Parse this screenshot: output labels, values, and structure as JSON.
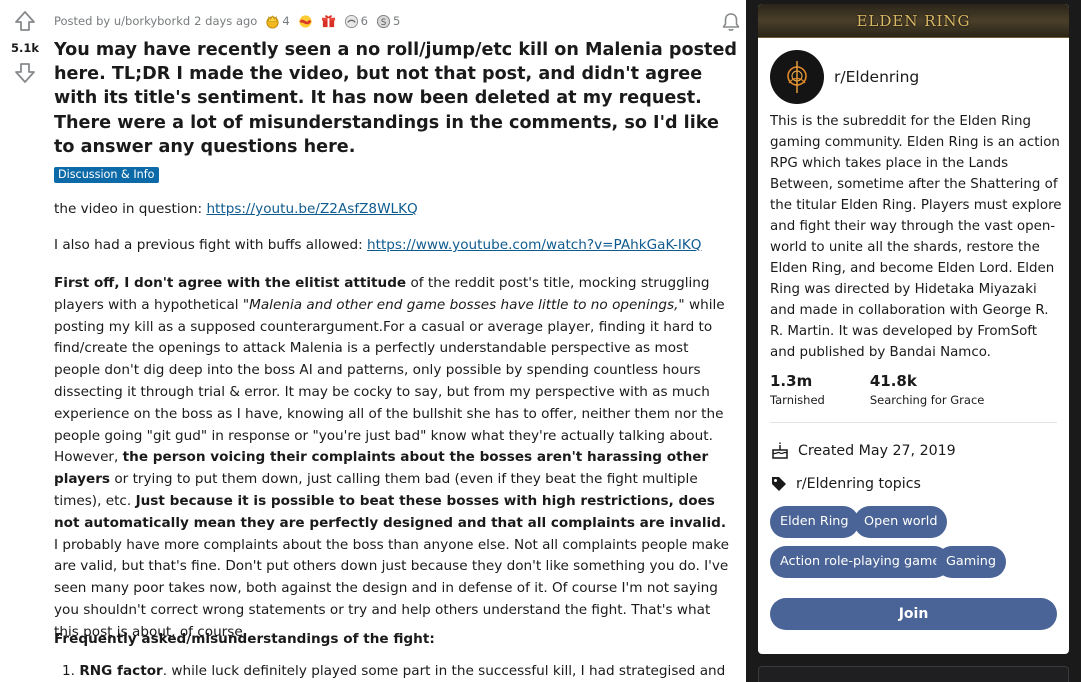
{
  "post": {
    "score": "5.1k",
    "posted_by": "Posted by u/borkyborkd",
    "time_ago": "2 days ago",
    "awards": [
      {
        "icon": "gold-award-icon",
        "count": "4"
      },
      {
        "icon": "wholesome-award-icon",
        "count": ""
      },
      {
        "icon": "gift-award-icon",
        "count": ""
      },
      {
        "icon": "hugz-award-icon",
        "count": "6"
      },
      {
        "icon": "silver-award-icon",
        "count": "5"
      }
    ],
    "title": "You may have recently seen a no roll/jump/etc kill on Malenia posted here. TL;DR I made the video, but not that post, and didn't agree with its title's sentiment. It has now been deleted at my request. There were a lot of misunderstandings in the comments, so I'd like to answer any questions here.",
    "flair": "Discussion & Info",
    "body": {
      "p1_prefix": "the video in question: ",
      "p1_link": "https://youtu.be/Z2AsfZ8WLKQ",
      "p2_prefix": "I also had a previous fight with buffs allowed: ",
      "p2_link": "https://www.youtube.com/watch?v=PAhkGaK-IKQ",
      "s1_bold": "First off, I don't agree with the elitist attitude",
      "s1_rest": " of the reddit post's title, mocking struggling players with a hypothetical ",
      "s1_italic": "\"Malenia and other end game bosses have little to no openings,\"",
      "s1_tail": " while posting my kill as a supposed counterargument.For a casual or average player, finding it hard to find/create the openings to attack Malenia is a perfectly understandable perspective as most people don't dig deep into the boss AI and patterns, only possible by spending countless hours dissecting it through trial & error. It may be cocky to say, but from my perspective with as much experience on the boss as I have, knowing all of the bullshit she has to offer, neither them nor the people going \"git gud\" in response or \"you're just bad\" know what they're actually talking about. However, ",
      "s2_bold": "the person voicing their complaints about the bosses aren't harassing other players",
      "s2_rest": " or trying to put them down, just calling them bad (even if they beat the fight multiple times), etc. ",
      "s3_bold": "Just because it is possible to beat these bosses with high restrictions, does not automatically mean they are perfectly designed and that all complaints are invalid.",
      "s3_rest": " I probably have more complaints about the boss than anyone else. Not all complaints people make are valid, but that's fine. Don't put others down just because they don't like something you do. I've seen many poor takes now, both against the design and in defense of it. Of course I'm not saying you shouldn't correct wrong statements or try and help others understand the fight. That's what this post is about, of course.",
      "faq_heading": "Frequently asked/misunderstandings of the fight:",
      "list1_num": "1.",
      "list1_bold": "RNG factor",
      "list1_rest": ". while luck definitely played some part in the successful kill, I had strategised and"
    }
  },
  "sidebar": {
    "banner": "ELDEN RING",
    "community_name": "r/Eldenring",
    "description": "This is the subreddit for the Elden Ring gaming community. Elden Ring is an action RPG which takes place in the Lands Between, sometime after the Shattering of the titular Elden Ring. Players must explore and fight their way through the vast open-world to unite all the shards, restore the Elden Ring, and become Elden Lord. Elden Ring was directed by Hidetaka Miyazaki and made in collaboration with George R. R. Martin. It was developed by FromSoft and published by Bandai Namco.",
    "members": "1.3m",
    "members_label": "Tarnished",
    "online": "41.8k",
    "online_label": "Searching for Grace",
    "created": "Created May 27, 2019",
    "topics_label": "r/Eldenring topics",
    "topics": [
      "Elden Ring",
      "Open world",
      "Action role-playing game",
      "Gaming"
    ],
    "join_label": "Join"
  },
  "colors": {
    "accent": "#4a6497",
    "flair": "#0d6aa8",
    "link": "#0f5b8f",
    "page_bg": "#1a1a1b"
  }
}
